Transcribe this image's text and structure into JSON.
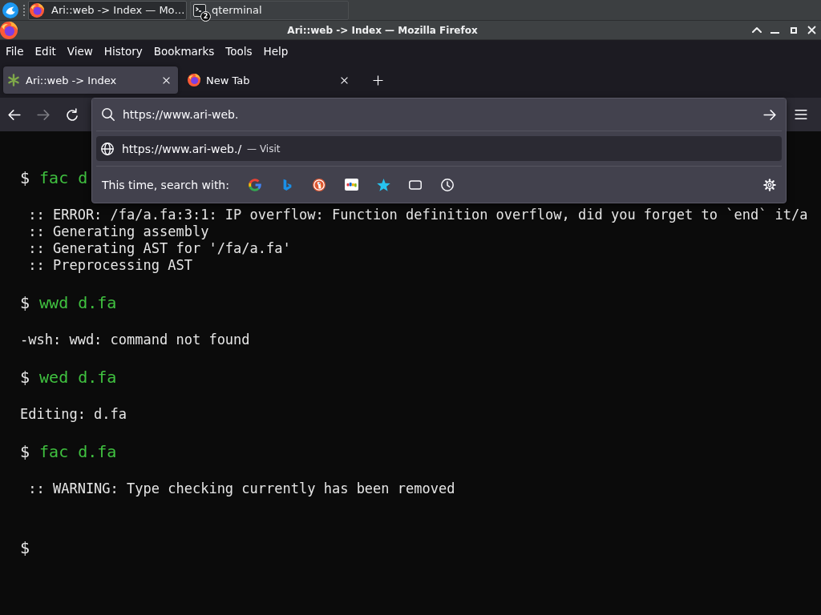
{
  "taskbar": {
    "tasks": [
      {
        "kind": "browser",
        "label": "Ari::web -> Index — Mo…",
        "selected": true
      },
      {
        "kind": "terminal",
        "label": "qterminal",
        "badge": "2",
        "selected": false
      }
    ]
  },
  "window": {
    "title": "Ari::web -> Index — Mozilla Firefox"
  },
  "menu_bar": {
    "items": [
      {
        "label": "File"
      },
      {
        "label": "Edit"
      },
      {
        "label": "View"
      },
      {
        "label": "History"
      },
      {
        "label": "Bookmarks"
      },
      {
        "label": "Tools"
      },
      {
        "label": "Help"
      }
    ]
  },
  "tabs": [
    {
      "kind": "site",
      "label": "Ari::web -> Index",
      "selected": true
    },
    {
      "kind": "new",
      "label": "New Tab",
      "selected": false
    }
  ],
  "toolbar": {
    "nav_buttons": [
      {
        "kind": "back",
        "disabled": false
      },
      {
        "kind": "forward",
        "disabled": true
      },
      {
        "kind": "reload",
        "disabled": false
      }
    ]
  },
  "address_bar": {
    "value": "https://www.ari-web.",
    "suggestions": [
      {
        "url": "https://www.ari-web./",
        "action": "— Visit",
        "selected": true
      }
    ],
    "search_with_label": "This time, search with:"
  },
  "terminal": {
    "entries": [
      {
        "kind": "command",
        "prompt": "$",
        "command": "fac d"
      },
      {
        "kind": "output",
        "lines": [
          " :: ERROR: /fa/a.fa:3:1: IP overflow: Function definition overflow, did you forget to `end` it/a",
          " :: Generating assembly",
          " :: Generating AST for '/fa/a.fa'",
          " :: Preprocessing AST"
        ]
      },
      {
        "kind": "command",
        "prompt": "$",
        "command": "wwd d.fa"
      },
      {
        "kind": "output",
        "lines": [
          "-wsh: wwd: command not found"
        ]
      },
      {
        "kind": "command",
        "prompt": "$",
        "command": "wed d.fa"
      },
      {
        "kind": "output",
        "lines": [
          "Editing: d.fa"
        ]
      },
      {
        "kind": "command",
        "prompt": "$",
        "command": "fac d.fa"
      },
      {
        "kind": "output",
        "lines": [
          " :: WARNING: Type checking currently has been removed"
        ]
      },
      {
        "kind": "prompt",
        "prompt": "$"
      }
    ]
  }
}
